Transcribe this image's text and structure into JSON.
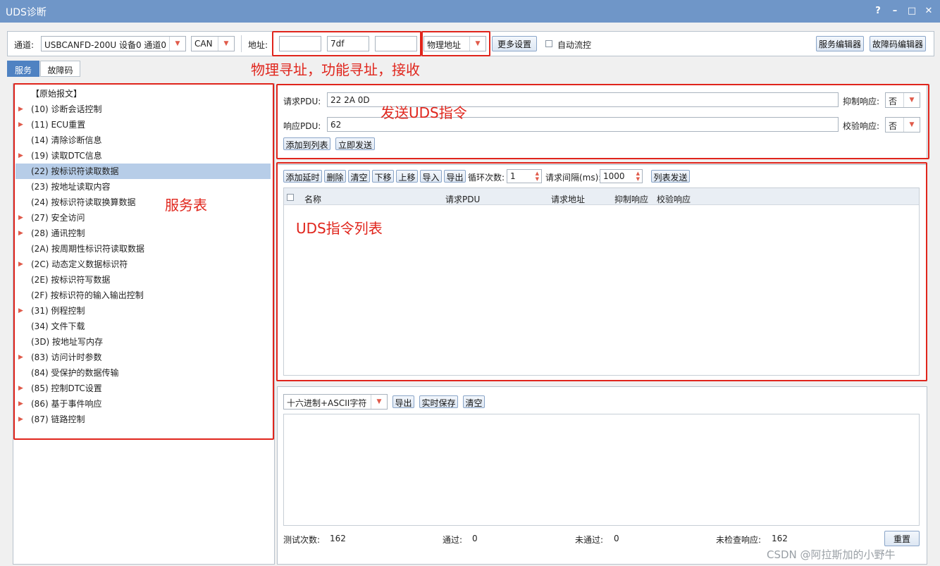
{
  "window": {
    "title": "UDS诊断",
    "controls": [
      "?",
      "–",
      "□",
      "✕"
    ]
  },
  "toolbar": {
    "channel_label": "通道:",
    "channel_value": "USBCANFD-200U 设备0 通道0",
    "protocol_value": "CAN",
    "address_label": "地址:",
    "address1": "",
    "address2": "7df",
    "address3": "",
    "address_type": "物理地址",
    "more_settings": "更多设置",
    "auto_flow_label": "自动流控",
    "service_editor": "服务编辑器",
    "fault_editor": "故障码编辑器"
  },
  "tabs": [
    {
      "label": "服务",
      "active": true
    },
    {
      "label": "故障码",
      "active": false
    }
  ],
  "annotations": {
    "address": "物理寻址，功能寻址，接收",
    "send": "发送UDS指令",
    "service_table": "服务表",
    "cmd_list": "UDS指令列表"
  },
  "tree": [
    {
      "label": "【原始报文】",
      "expand": false,
      "selected": false
    },
    {
      "label": "(10) 诊断会话控制",
      "expand": true,
      "selected": false
    },
    {
      "label": "(11) ECU重置",
      "expand": true,
      "selected": false
    },
    {
      "label": "(14) 清除诊断信息",
      "expand": false,
      "selected": false
    },
    {
      "label": "(19) 读取DTC信息",
      "expand": true,
      "selected": false
    },
    {
      "label": "(22) 按标识符读取数据",
      "expand": false,
      "selected": true
    },
    {
      "label": "(23) 按地址读取内容",
      "expand": false,
      "selected": false
    },
    {
      "label": "(24) 按标识符读取换算数据",
      "expand": false,
      "selected": false
    },
    {
      "label": "(27) 安全访问",
      "expand": true,
      "selected": false
    },
    {
      "label": "(28) 通讯控制",
      "expand": true,
      "selected": false
    },
    {
      "label": "(2A) 按周期性标识符读取数据",
      "expand": false,
      "selected": false
    },
    {
      "label": "(2C) 动态定义数据标识符",
      "expand": true,
      "selected": false
    },
    {
      "label": "(2E) 按标识符写数据",
      "expand": false,
      "selected": false
    },
    {
      "label": "(2F) 按标识符的输入输出控制",
      "expand": false,
      "selected": false
    },
    {
      "label": "(31) 例程控制",
      "expand": true,
      "selected": false
    },
    {
      "label": "(34) 文件下载",
      "expand": false,
      "selected": false
    },
    {
      "label": "(3D) 按地址写内存",
      "expand": false,
      "selected": false
    },
    {
      "label": "(83) 访问计时参数",
      "expand": true,
      "selected": false
    },
    {
      "label": "(84) 受保护的数据传输",
      "expand": false,
      "selected": false
    },
    {
      "label": "(85) 控制DTC设置",
      "expand": true,
      "selected": false
    },
    {
      "label": "(86) 基于事件响应",
      "expand": true,
      "selected": false
    },
    {
      "label": "(87) 链路控制",
      "expand": true,
      "selected": false
    }
  ],
  "request": {
    "req_label": "请求PDU:",
    "req_value": "22 2A 0D",
    "resp_label": "响应PDU:",
    "resp_value": "62",
    "suppress_label": "抑制响应:",
    "suppress_value": "否",
    "verify_label": "校验响应:",
    "verify_value": "否",
    "add_to_list": "添加到列表",
    "send_now": "立即发送"
  },
  "list_toolbar": {
    "add_delay": "添加延时",
    "delete": "删除",
    "clear": "清空",
    "move_down": "下移",
    "move_up": "上移",
    "import": "导入",
    "export": "导出",
    "loop_label": "循环次数:",
    "loop_value": "1",
    "interval_label": "请求间隔(ms):",
    "interval_value": "1000",
    "list_send": "列表发送"
  },
  "list_columns": [
    "名称",
    "请求PDU",
    "请求地址",
    "抑制响应",
    "校验响应"
  ],
  "log": {
    "format_value": "十六进制+ASCII字符",
    "export": "导出",
    "realtime_save": "实时保存",
    "clear": "清空"
  },
  "stats": {
    "tests_label": "测试次数:",
    "tests_value": "162",
    "pass_label": "通过:",
    "pass_value": "0",
    "fail_label": "未通过:",
    "fail_value": "0",
    "unchecked_label": "未检查响应:",
    "unchecked_value": "162",
    "reset": "重置"
  },
  "watermark": "CSDN @阿拉斯加的小野牛",
  "colors": {
    "titlebar": "#6f96c8",
    "annotation": "#e0251c",
    "selection": "#b7cde8",
    "tab_active": "#4f82c2"
  }
}
